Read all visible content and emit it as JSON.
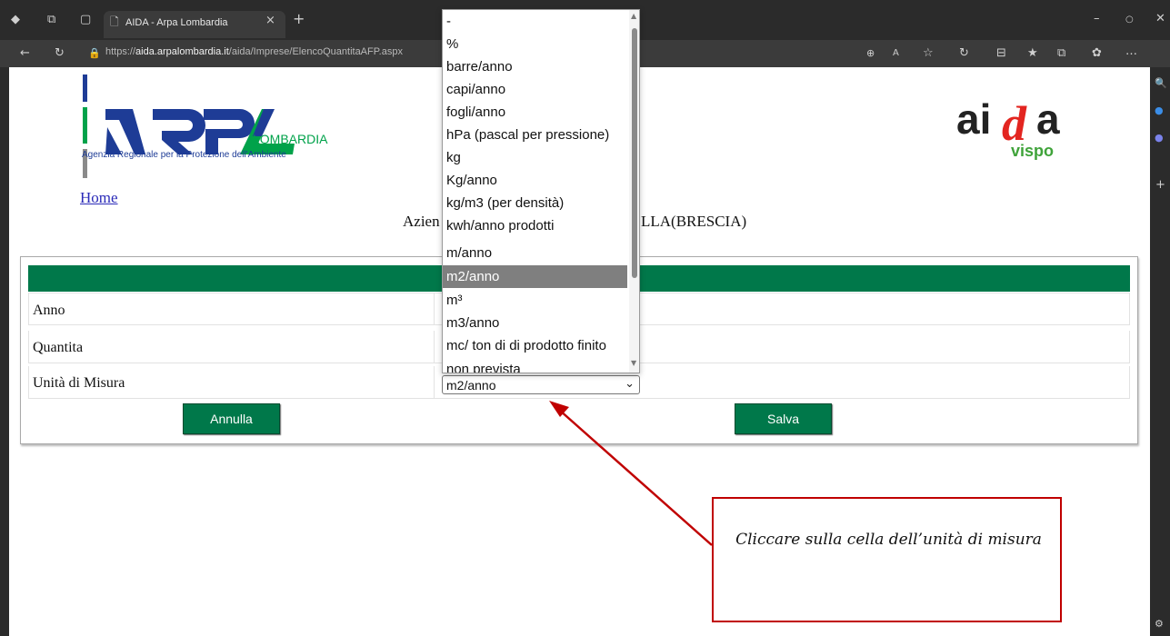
{
  "browser": {
    "tab_title": "AIDA - Arpa Lombardia",
    "tab_close": "×",
    "new_tab": "+",
    "url_prefix": "https://",
    "url_domain": "aida.arpalombardia.it",
    "url_path": "/aida/Imprese/ElencoQuantitaAFP.aspx"
  },
  "page": {
    "logo_arpa_text": "LOMBARDIA",
    "logo_arpa_subtitle": "Agenzia Regionale per la Protezione dell'Ambiente",
    "logo_aida_main": "ai",
    "logo_aida_d": "d",
    "logo_aida_a": "a",
    "logo_aida_sub": "vispo",
    "home_link": "Home",
    "company_visible_left": "Azien",
    "company_visible_right": "LLA(BRESCIA)"
  },
  "form": {
    "rows": [
      {
        "label": "Anno"
      },
      {
        "label": "Quantita"
      },
      {
        "label": "Unità di Misura"
      }
    ],
    "unit_select_value": "m2/anno",
    "cancel_label": "Annulla",
    "save_label": "Salva"
  },
  "dropdown": {
    "options": [
      "-",
      "%",
      "barre/anno",
      "capi/anno",
      "fogli/anno",
      "hPa (pascal per pressione)",
      "kg",
      "Kg/anno",
      "kg/m3 (per densità)",
      "kwh/anno prodotti",
      "m/anno",
      "m2/anno",
      "m³",
      "m3/anno",
      "mc/ ton di di prodotto finito",
      "non prevista"
    ],
    "selected": "m2/anno"
  },
  "annotation": {
    "text": "Cliccare sulla cella dell’unità di misura"
  },
  "colors": {
    "brand_green": "#00784a",
    "annotation_red": "#c00000"
  }
}
